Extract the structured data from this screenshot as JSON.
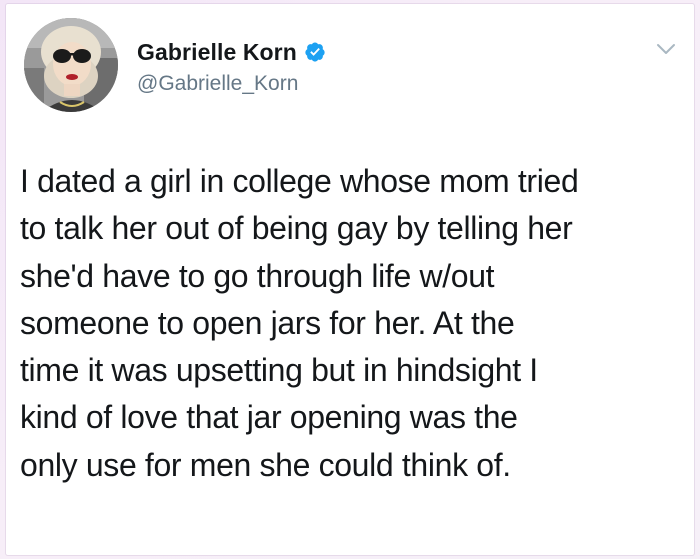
{
  "tweet": {
    "author": {
      "display_name": "Gabrielle Korn",
      "handle": "@Gabrielle_Korn",
      "verified": true
    },
    "text_lines": [
      "I dated a girl in college whose mom tried",
      "to talk her out of being gay by telling her",
      "she'd have to go through life w/out",
      "someone to open jars for her. At the",
      "time it was upsetting but in hindsight I",
      "kind of love that jar opening was the",
      "only use for men she could think of."
    ]
  },
  "icons": {
    "verified": "verified-badge-icon",
    "menu": "chevron-down-icon"
  },
  "colors": {
    "verified_blue": "#1da1f2",
    "text": "#14171a",
    "secondary_text": "#657786",
    "frame_background": "#f3e6f7"
  }
}
